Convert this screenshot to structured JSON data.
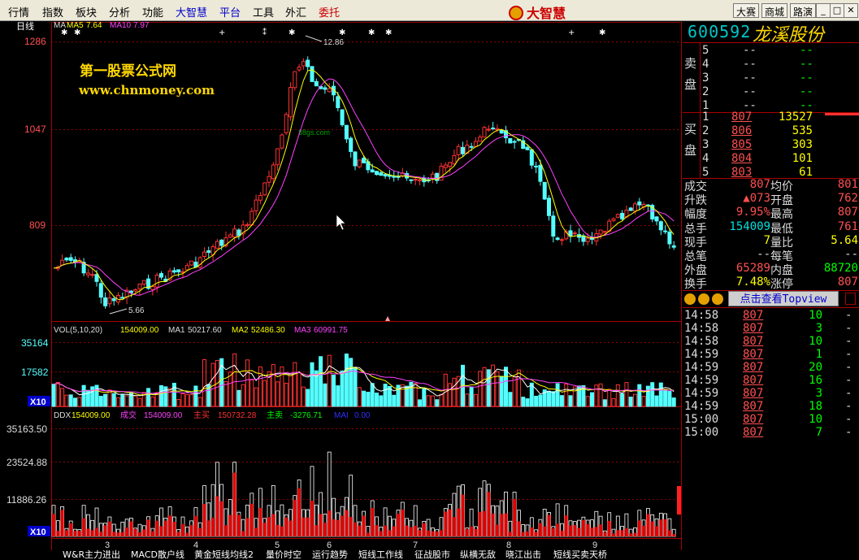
{
  "menu": {
    "items": [
      "行情",
      "指数",
      "板块",
      "分析",
      "功能",
      "大智慧",
      "平台",
      "工具",
      "外汇",
      "委托"
    ],
    "logo": "大智慧",
    "buttons": [
      "大赛",
      "商城",
      "路演"
    ]
  },
  "chart": {
    "period_label": "日线",
    "ma_legend": {
      "ma": "MA",
      "ma5": "MA5",
      "ma5_val": "7.64",
      "ma10": "MA10",
      "ma10_val": "7.97"
    },
    "y_ticks": [
      "1286",
      "1047",
      "809"
    ],
    "watermark_cn": "第一股票公式网",
    "watermark_url": "www.chnmoney.com",
    "watermark_small": "88gs.com",
    "high_label": "12.86",
    "low_label": "5.66",
    "vol_legend": {
      "title": "VOL(5,10,20)",
      "val": "154009.00",
      "ma1": "MA1",
      "ma1_val": "50217.60",
      "ma2": "MA2",
      "ma2_val": "52486.30",
      "ma3": "MA3",
      "ma3_val": "60991.75"
    },
    "vol_ticks": [
      "35164",
      "17582"
    ],
    "vol_mult": "X10",
    "ddx_legend": {
      "title": "DDX",
      "val": "154009.00",
      "cj": "成交",
      "cj_val": "154009.00",
      "zm": "主买",
      "zm_val": "150732.28",
      "zs": "主卖",
      "zs_val": "-3276.71",
      "mai": "MAI",
      "mai_val": "0.00"
    },
    "ddx_ticks": [
      "35163.50",
      "23524.88",
      "11886.26"
    ],
    "ddx_mult": "X10",
    "x_labels": [
      "3",
      "4",
      "5",
      "6",
      "7",
      "8",
      "9"
    ]
  },
  "tabs": [
    "W&R",
    "主力进出",
    "MACD",
    "散户线",
    "黄金短线均线2",
    "量价时空",
    "运行趋势",
    "短线工作线",
    "征战股市",
    "纵横无敌",
    "晓江出击",
    "短线买卖天桥"
  ],
  "quote": {
    "code": "600592",
    "name": "龙溪股份",
    "sell_label": "卖盘",
    "buy_label": "买盘",
    "asks": [
      {
        "n": "5",
        "p": "--",
        "v": "--"
      },
      {
        "n": "4",
        "p": "--",
        "v": "--"
      },
      {
        "n": "3",
        "p": "--",
        "v": "--"
      },
      {
        "n": "2",
        "p": "--",
        "v": "--"
      },
      {
        "n": "1",
        "p": "--",
        "v": "--"
      }
    ],
    "bids": [
      {
        "n": "1",
        "p": "807",
        "v": "13527"
      },
      {
        "n": "2",
        "p": "806",
        "v": "535"
      },
      {
        "n": "3",
        "p": "805",
        "v": "303"
      },
      {
        "n": "4",
        "p": "804",
        "v": "101"
      },
      {
        "n": "5",
        "p": "803",
        "v": "61"
      }
    ],
    "stats": [
      {
        "l1": "成交",
        "v1": "807",
        "l2": "均价",
        "v2": "801"
      },
      {
        "l1": "升跌",
        "v1": "▲073",
        "l2": "开盘",
        "v2": "762"
      },
      {
        "l1": "幅度",
        "v1": "9.95%",
        "l2": "最高",
        "v2": "807"
      },
      {
        "l1": "总手",
        "v1": "154009",
        "l2": "最低",
        "v2": "761"
      },
      {
        "l1": "现手",
        "v1": "7",
        "l2": "量比",
        "v2": "5.64"
      },
      {
        "l1": "总笔",
        "v1": "--",
        "l2": "每笔",
        "v2": "--"
      },
      {
        "l1": "外盘",
        "v1": "65289",
        "l2": "内盘",
        "v2": "88720"
      },
      {
        "l1": "换手",
        "v1": "7.48%",
        "l2": "涨停",
        "v2": "807"
      }
    ],
    "topview": "点击查看Topview",
    "ticks": [
      {
        "t": "14:58",
        "p": "807",
        "v": "10"
      },
      {
        "t": "14:58",
        "p": "807",
        "v": "3"
      },
      {
        "t": "14:58",
        "p": "807",
        "v": "10"
      },
      {
        "t": "14:59",
        "p": "807",
        "v": "1"
      },
      {
        "t": "14:59",
        "p": "807",
        "v": "20"
      },
      {
        "t": "14:59",
        "p": "807",
        "v": "16"
      },
      {
        "t": "14:59",
        "p": "807",
        "v": "3"
      },
      {
        "t": "14:59",
        "p": "807",
        "v": "18"
      },
      {
        "t": "15:00",
        "p": "807",
        "v": "10"
      },
      {
        "t": "15:00",
        "p": "807",
        "v": "7"
      }
    ]
  },
  "chart_data": {
    "type": "candlestick",
    "title": "日线",
    "ylim": [
      5.66,
      12.86
    ],
    "y_ticks": [
      "1286",
      "1047",
      "809"
    ],
    "x_labels": [
      "3",
      "4",
      "5",
      "6",
      "7",
      "8",
      "9"
    ],
    "series": [
      {
        "name": "MA5",
        "last": 7.64
      },
      {
        "name": "MA10",
        "last": 7.97
      }
    ],
    "high": 12.86,
    "low": 5.66,
    "volume": {
      "ticks": [
        "35164",
        "17582"
      ],
      "last": 154009.0
    },
    "ddx": {
      "ticks": [
        "35163.50",
        "23524.88",
        "11886.26"
      ],
      "last": 154009.0
    }
  },
  "colors": {
    "up": "#ff3232",
    "down": "#54ffff",
    "ma5": "#ffff00",
    "ma10": "#ff40ff",
    "grid": "#8b0000"
  }
}
